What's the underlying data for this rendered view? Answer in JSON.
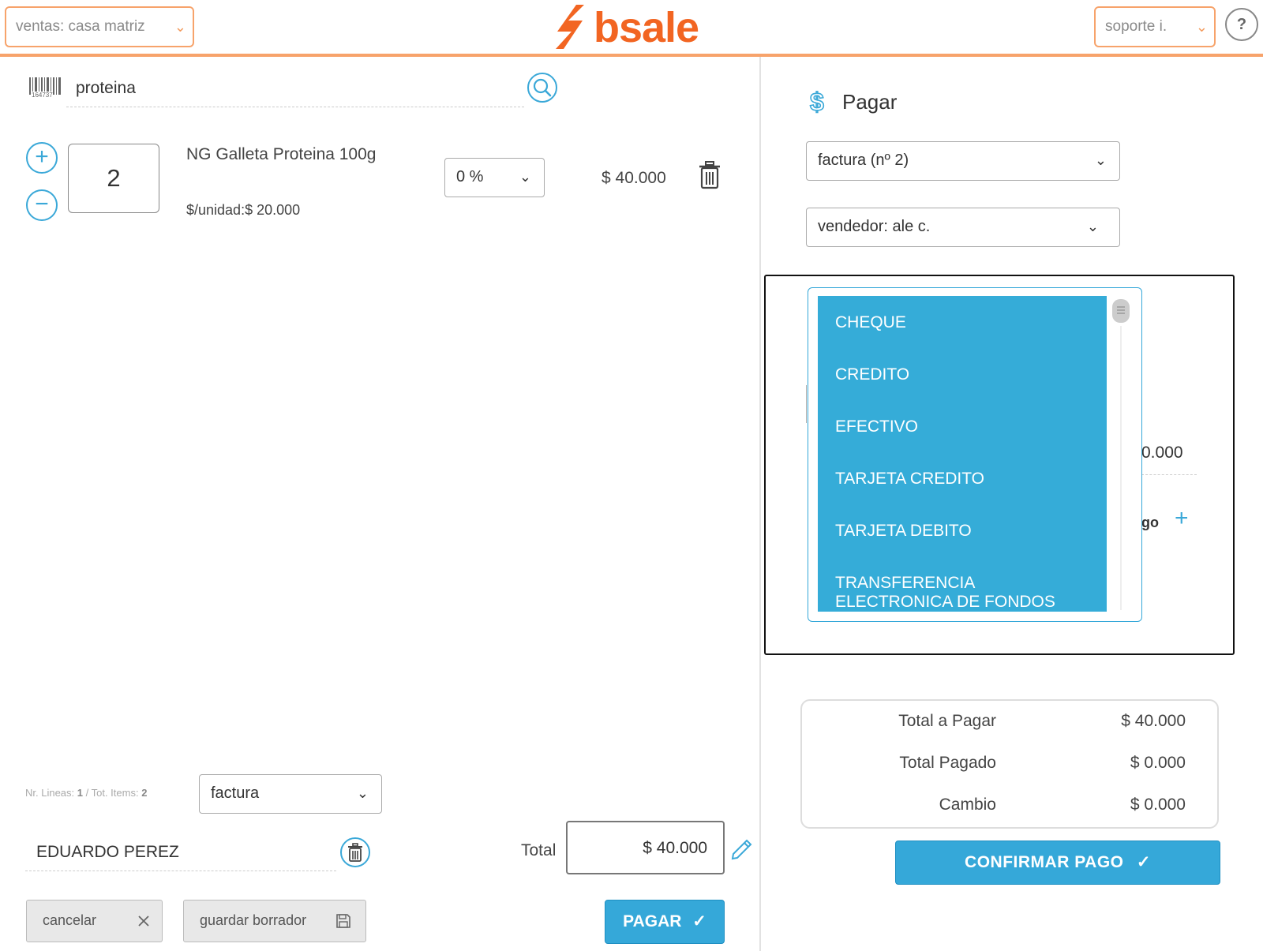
{
  "header": {
    "branch_select": "ventas: casa matriz",
    "logo_text": "bsale",
    "user_select": "soporte i.",
    "help": "?"
  },
  "search": {
    "value": "proteina",
    "barcode_caption": "164737"
  },
  "line_item": {
    "quantity": "2",
    "name": "NG Galleta Proteina 100g",
    "unit_price": "$/unidad:$ 20.000",
    "discount": "0 %",
    "subtotal": "$ 40.000"
  },
  "footer_left": {
    "summary_prefix": "Nr. Lineas: ",
    "lines": "1",
    "summary_mid": " / Tot. Items: ",
    "items": "2",
    "doc_type": "factura",
    "client": "EDUARDO PEREZ",
    "total_label": "Total",
    "total_value": "$ 40.000",
    "cancel": "cancelar",
    "save_draft": "guardar borrador",
    "pay": "PAGAR"
  },
  "pay_panel": {
    "title": "Pagar",
    "document_select": "factura (nº 2)",
    "seller_select": "vendedor: ale c.",
    "payment_methods": [
      "CHEQUE",
      "CREDITO",
      "EFECTIVO",
      "TARJETA CREDITO",
      "TARJETA DEBITO",
      "TRANSFERENCIA ELECTRONICA DE FONDOS"
    ],
    "hidden_amount_fragment": "0.000",
    "hidden_label_fragment": "go",
    "add": "+"
  },
  "totals": {
    "to_pay_label": "Total a Pagar",
    "to_pay_value": "$ 40.000",
    "paid_label": "Total Pagado",
    "paid_value": "$ 0.000",
    "change_label": "Cambio",
    "change_value": "$ 0.000"
  },
  "confirm_button": "CONFIRMAR PAGO",
  "colors": {
    "brand_orange": "#f26522",
    "accent_blue": "#35a8d9",
    "header_border": "#f7a36b"
  }
}
